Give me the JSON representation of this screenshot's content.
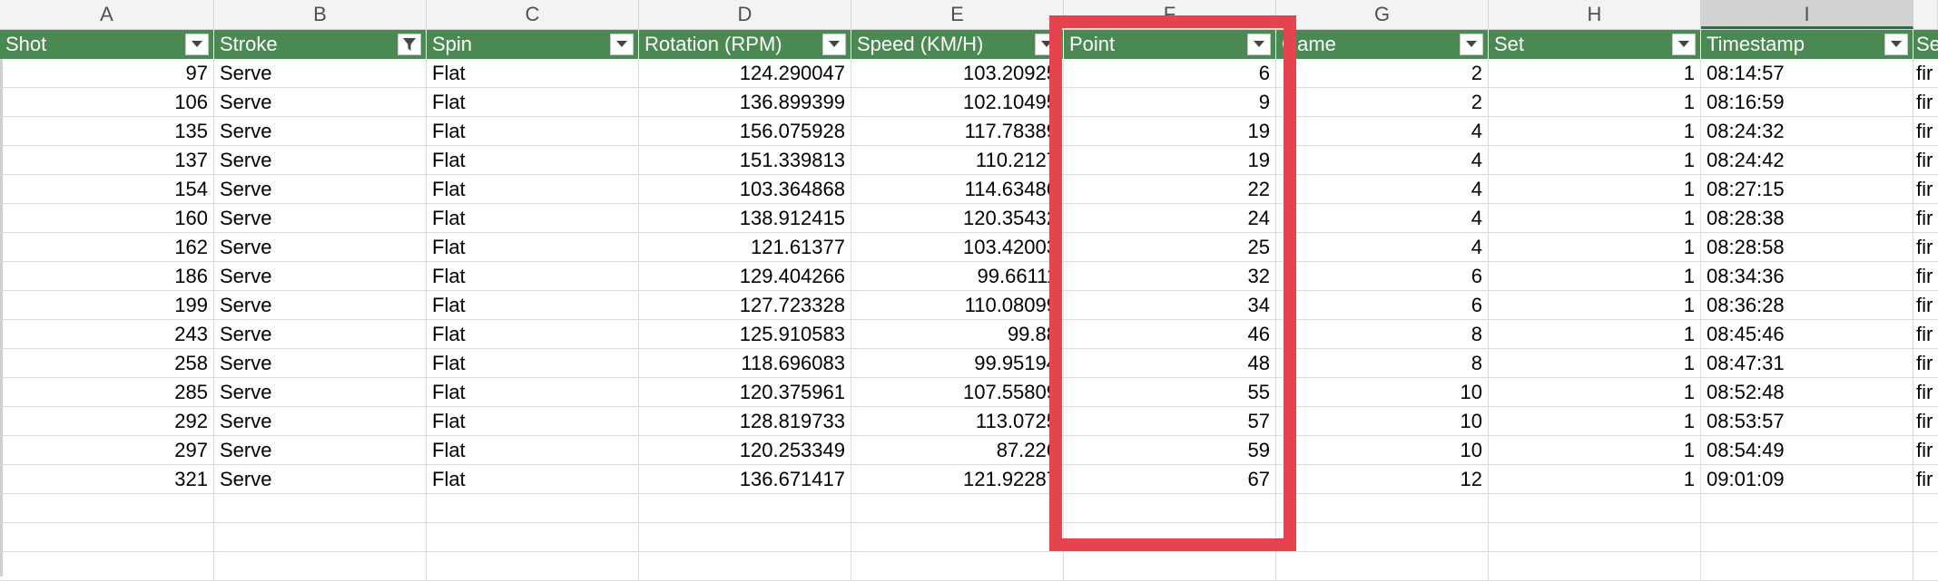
{
  "column_letters": [
    "A",
    "B",
    "C",
    "D",
    "E",
    "F",
    "G",
    "H",
    "I"
  ],
  "selected_column": "I",
  "headers": [
    "Shot",
    "Stroke",
    "Spin",
    "Rotation (RPM)",
    "Speed (KM/H)",
    "Point",
    "Game",
    "Set",
    "Timestamp",
    "Se"
  ],
  "header_filters": {
    "stroke_filtered": true,
    "filter_icon": "chevron-down-icon",
    "active_filter_icon": "funnel-icon"
  },
  "rows": [
    {
      "shot": "97",
      "stroke": "Serve",
      "spin": "Flat",
      "rotation": "124.290047",
      "speed": "103.20925",
      "point": "6",
      "game": "2",
      "set": "1",
      "timestamp": "08:14:57",
      "extra": "fir"
    },
    {
      "shot": "106",
      "stroke": "Serve",
      "spin": "Flat",
      "rotation": "136.899399",
      "speed": "102.10495",
      "point": "9",
      "game": "2",
      "set": "1",
      "timestamp": "08:16:59",
      "extra": "fir"
    },
    {
      "shot": "135",
      "stroke": "Serve",
      "spin": "Flat",
      "rotation": "156.075928",
      "speed": "117.78389",
      "point": "19",
      "game": "4",
      "set": "1",
      "timestamp": "08:24:32",
      "extra": "fir"
    },
    {
      "shot": "137",
      "stroke": "Serve",
      "spin": "Flat",
      "rotation": "151.339813",
      "speed": "110.2127",
      "point": "19",
      "game": "4",
      "set": "1",
      "timestamp": "08:24:42",
      "extra": "fir"
    },
    {
      "shot": "154",
      "stroke": "Serve",
      "spin": "Flat",
      "rotation": "103.364868",
      "speed": "114.63486",
      "point": "22",
      "game": "4",
      "set": "1",
      "timestamp": "08:27:15",
      "extra": "fir"
    },
    {
      "shot": "160",
      "stroke": "Serve",
      "spin": "Flat",
      "rotation": "138.912415",
      "speed": "120.35432",
      "point": "24",
      "game": "4",
      "set": "1",
      "timestamp": "08:28:38",
      "extra": "fir"
    },
    {
      "shot": "162",
      "stroke": "Serve",
      "spin": "Flat",
      "rotation": "121.61377",
      "speed": "103.42003",
      "point": "25",
      "game": "4",
      "set": "1",
      "timestamp": "08:28:58",
      "extra": "fir"
    },
    {
      "shot": "186",
      "stroke": "Serve",
      "spin": "Flat",
      "rotation": "129.404266",
      "speed": "99.66111",
      "point": "32",
      "game": "6",
      "set": "1",
      "timestamp": "08:34:36",
      "extra": "fir"
    },
    {
      "shot": "199",
      "stroke": "Serve",
      "spin": "Flat",
      "rotation": "127.723328",
      "speed": "110.08099",
      "point": "34",
      "game": "6",
      "set": "1",
      "timestamp": "08:36:28",
      "extra": "fir"
    },
    {
      "shot": "243",
      "stroke": "Serve",
      "spin": "Flat",
      "rotation": "125.910583",
      "speed": "99.88",
      "point": "46",
      "game": "8",
      "set": "1",
      "timestamp": "08:45:46",
      "extra": "fir"
    },
    {
      "shot": "258",
      "stroke": "Serve",
      "spin": "Flat",
      "rotation": "118.696083",
      "speed": "99.95194",
      "point": "48",
      "game": "8",
      "set": "1",
      "timestamp": "08:47:31",
      "extra": "fir"
    },
    {
      "shot": "285",
      "stroke": "Serve",
      "spin": "Flat",
      "rotation": "120.375961",
      "speed": "107.55809",
      "point": "55",
      "game": "10",
      "set": "1",
      "timestamp": "08:52:48",
      "extra": "fir"
    },
    {
      "shot": "292",
      "stroke": "Serve",
      "spin": "Flat",
      "rotation": "128.819733",
      "speed": "113.0725",
      "point": "57",
      "game": "10",
      "set": "1",
      "timestamp": "08:53:57",
      "extra": "fir"
    },
    {
      "shot": "297",
      "stroke": "Serve",
      "spin": "Flat",
      "rotation": "120.253349",
      "speed": "87.226",
      "point": "59",
      "game": "10",
      "set": "1",
      "timestamp": "08:54:49",
      "extra": "fir"
    },
    {
      "shot": "321",
      "stroke": "Serve",
      "spin": "Flat",
      "rotation": "136.671417",
      "speed": "121.92287",
      "point": "67",
      "game": "12",
      "set": "1",
      "timestamp": "09:01:09",
      "extra": "fir"
    }
  ],
  "colors": {
    "table_header": "#4a8a52",
    "highlight": "#e5444f",
    "grid": "#dcdcdc"
  }
}
